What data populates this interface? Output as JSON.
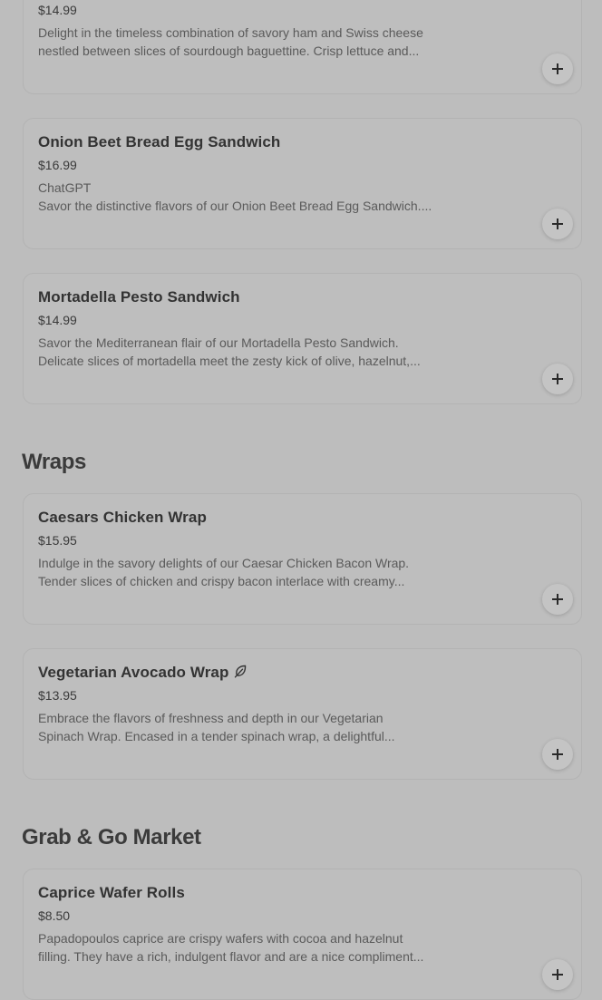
{
  "sections": [
    {
      "title": "",
      "items": [
        {
          "name": "",
          "price": "$14.99",
          "desc": [
            "Delight in the timeless combination of savory ham and Swiss cheese",
            "nestled between slices of sourdough baguettine. Crisp lettuce and..."
          ],
          "vegetarian": false
        },
        {
          "name": "Onion Beet Bread Egg Sandwich",
          "price": "$16.99",
          "desc": [
            "ChatGPT",
            "Savor the distinctive flavors of our Onion Beet Bread Egg Sandwich...."
          ],
          "vegetarian": false
        },
        {
          "name": "Mortadella Pesto Sandwich",
          "price": "$14.99",
          "desc": [
            "Savor the Mediterranean flair of our Mortadella Pesto Sandwich.",
            "Delicate slices of mortadella meet the zesty kick of olive, hazelnut,..."
          ],
          "vegetarian": false
        }
      ]
    },
    {
      "title": "Wraps",
      "items": [
        {
          "name": "Caesars Chicken Wrap",
          "price": "$15.95",
          "desc": [
            "Indulge in the savory delights of our Caesar Chicken Bacon Wrap.",
            "Tender slices of chicken and crispy bacon interlace with creamy..."
          ],
          "vegetarian": false
        },
        {
          "name": "Vegetarian Avocado Wrap",
          "price": "$13.95",
          "desc": [
            "Embrace the flavors of freshness and depth in our Vegetarian",
            "Spinach Wrap. Encased in a tender spinach wrap, a delightful..."
          ],
          "vegetarian": true
        }
      ]
    },
    {
      "title": "Grab & Go Market",
      "items": [
        {
          "name": "Caprice Wafer Rolls",
          "price": "$8.50",
          "desc": [
            "Papadopoulos caprice are crispy wafers with cocoa and hazelnut",
            "filling. They have a rich, indulgent flavor and are a nice compliment..."
          ],
          "vegetarian": false
        }
      ]
    }
  ],
  "icons": {
    "add": "plus-icon",
    "vegetarian": "leaf-icon"
  },
  "colors": {
    "background": "#bdbdbd",
    "card_border": "#b3b3b3",
    "text_primary": "#333333",
    "text_secondary": "#5a5a5a"
  }
}
